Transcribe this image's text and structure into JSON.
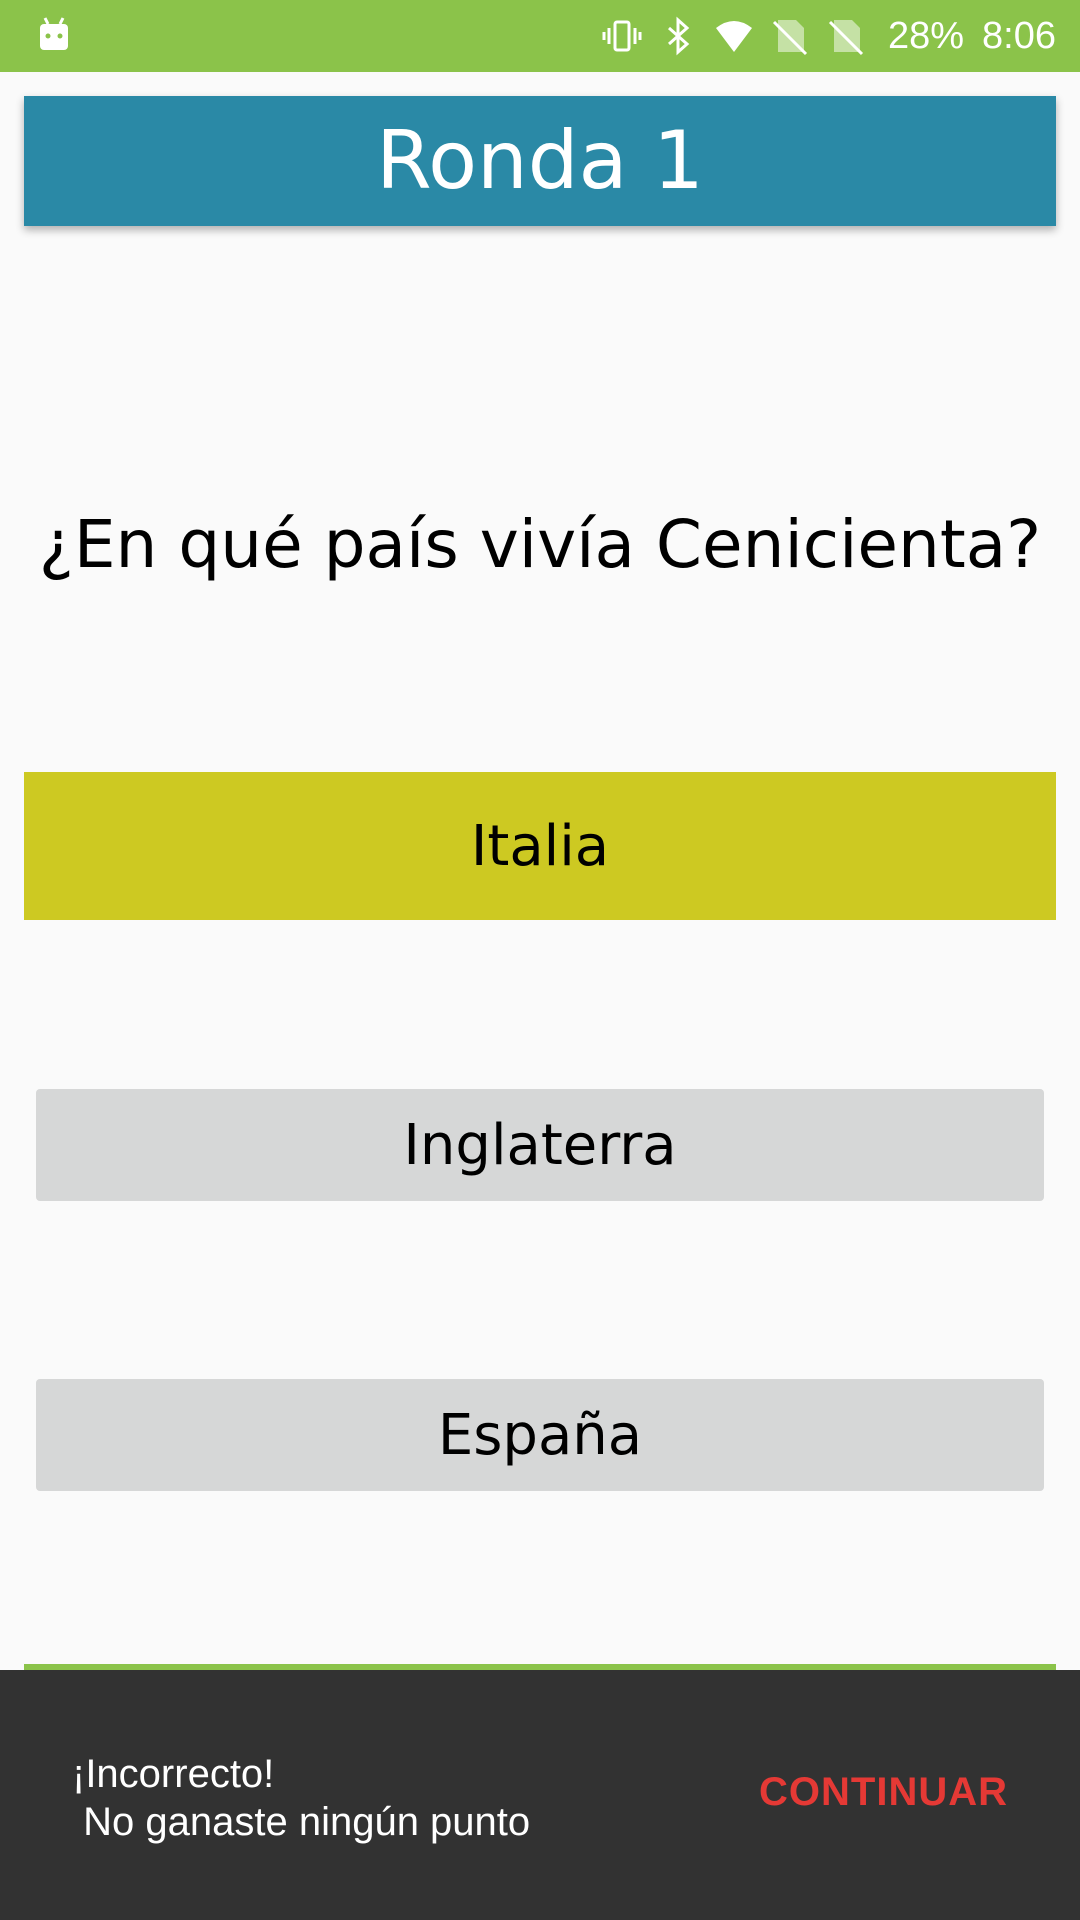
{
  "status_bar": {
    "left_icon": "android-icon",
    "icons": [
      "vibrate-icon",
      "bluetooth-icon",
      "wifi-icon",
      "no-sim-icon",
      "no-sim-icon"
    ],
    "battery": "28%",
    "time": "8:06",
    "background_color": "#8bc34a"
  },
  "header": {
    "title": "Ronda 1",
    "background_color": "#2a89a6"
  },
  "question": {
    "text": "¿En qué país vivía Cenicienta?"
  },
  "answers": [
    {
      "label": "Italia",
      "selected": true,
      "color": "#cdc922"
    },
    {
      "label": "Inglaterra",
      "selected": false,
      "color": "#d6d7d7"
    },
    {
      "label": "España",
      "selected": false,
      "color": "#d6d7d7"
    }
  ],
  "snackbar": {
    "message": "¡Incorrecto!\n No ganaste ningún punto",
    "action_label": "CONTINUAR",
    "background_color": "#323232",
    "action_color": "#e53935"
  }
}
